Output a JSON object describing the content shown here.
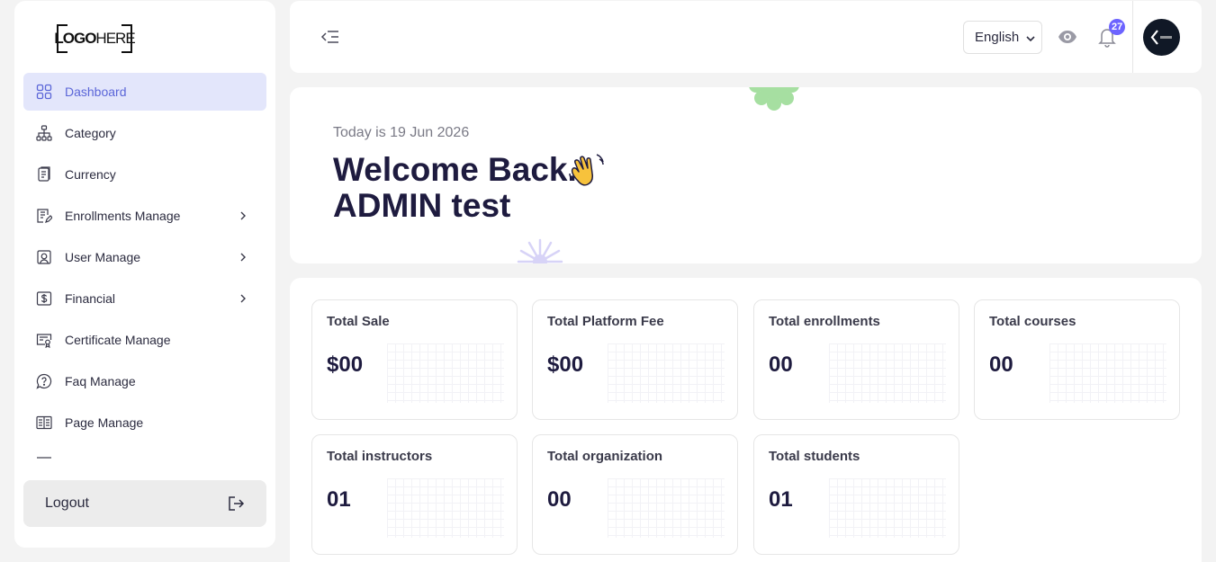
{
  "logo": {
    "bold": "LOGO",
    "light": "HERE"
  },
  "sidebar": {
    "items": [
      {
        "label": "Dashboard",
        "icon": "grid-icon",
        "active": true,
        "submenu": false
      },
      {
        "label": "Category",
        "icon": "sitemap-icon",
        "active": false,
        "submenu": false
      },
      {
        "label": "Currency",
        "icon": "currency-icon",
        "active": false,
        "submenu": false
      },
      {
        "label": "Enrollments Manage",
        "icon": "document-edit-icon",
        "active": false,
        "submenu": true
      },
      {
        "label": "User Manage",
        "icon": "user-portrait-icon",
        "active": false,
        "submenu": true
      },
      {
        "label": "Financial",
        "icon": "dollar-icon",
        "active": false,
        "submenu": true
      },
      {
        "label": "Certificate Manage",
        "icon": "certificate-icon",
        "active": false,
        "submenu": false
      },
      {
        "label": "Faq Manage",
        "icon": "question-bubble-icon",
        "active": false,
        "submenu": false
      },
      {
        "label": "Page Manage",
        "icon": "page-layout-icon",
        "active": false,
        "submenu": false
      }
    ],
    "logout_label": "Logout"
  },
  "header": {
    "language": "English",
    "notification_count": "27"
  },
  "welcome": {
    "date_text": "Today is 19 Jun 2026",
    "greeting_line1": "Welcome Back.",
    "greeting_line2": "ADMIN test"
  },
  "stats": [
    {
      "label": "Total Sale",
      "value": "$00"
    },
    {
      "label": "Total Platform Fee",
      "value": "$00"
    },
    {
      "label": "Total enrollments",
      "value": "00"
    },
    {
      "label": "Total courses",
      "value": "00"
    },
    {
      "label": "Total instructors",
      "value": "01"
    },
    {
      "label": "Total organization",
      "value": "00"
    },
    {
      "label": "Total students",
      "value": "01"
    }
  ],
  "colors": {
    "accent": "#5b66d8",
    "active_bg": "#e3e6fb",
    "badge": "#6c63ff",
    "text_dark": "#1e1b3f"
  }
}
